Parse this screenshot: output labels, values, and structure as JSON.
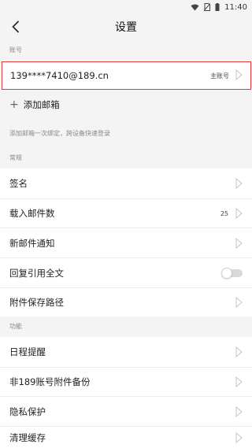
{
  "status_bar": {
    "time": "11:40"
  },
  "header": {
    "title": "设置"
  },
  "account_section": {
    "label": "账号",
    "email": "139****7410@189.cn",
    "tag": "主账号",
    "add_label": "添加邮箱",
    "hint": "添加邮箱一次绑定，跨设备快速登录"
  },
  "general_section": {
    "label": "常规",
    "items": [
      {
        "label": "签名",
        "value": ""
      },
      {
        "label": "载入邮件数",
        "value": "25"
      },
      {
        "label": "新邮件通知",
        "value": ""
      },
      {
        "label": "回复引用全文",
        "value": ""
      },
      {
        "label": "附件保存路径",
        "value": ""
      }
    ]
  },
  "features_section": {
    "label": "功能",
    "items": [
      {
        "label": "日程提醒"
      },
      {
        "label": "非189账号附件备份"
      },
      {
        "label": "隐私保护"
      },
      {
        "label": "清理缓存"
      }
    ]
  },
  "colors": {
    "accent_border": "#e03a3a",
    "background": "#f4f4f4"
  }
}
